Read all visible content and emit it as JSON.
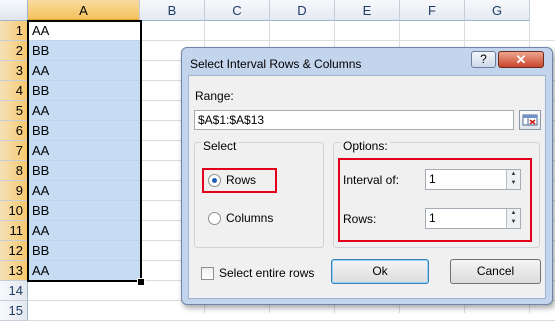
{
  "sheet": {
    "columns": [
      "A",
      "B",
      "C",
      "D",
      "E",
      "F",
      "G"
    ],
    "selected_column": "A",
    "rows": [
      {
        "num": "1",
        "value": "AA"
      },
      {
        "num": "2",
        "value": "BB"
      },
      {
        "num": "3",
        "value": "AA"
      },
      {
        "num": "4",
        "value": "BB"
      },
      {
        "num": "5",
        "value": "AA"
      },
      {
        "num": "6",
        "value": "BB"
      },
      {
        "num": "7",
        "value": "AA"
      },
      {
        "num": "8",
        "value": "BB"
      },
      {
        "num": "9",
        "value": "AA"
      },
      {
        "num": "10",
        "value": "BB"
      },
      {
        "num": "11",
        "value": "AA"
      },
      {
        "num": "12",
        "value": "BB"
      },
      {
        "num": "13",
        "value": "AA"
      },
      {
        "num": "14",
        "value": ""
      },
      {
        "num": "15",
        "value": ""
      }
    ],
    "selection_color": "#c6dcf2"
  },
  "dialog": {
    "title": "Select Interval Rows & Columns",
    "help_label": "?",
    "close_label": "✕",
    "range_label": "Range:",
    "range_value": "$A$1:$A$13",
    "range_button_icon": "range-select-icon",
    "select_group_title": "Select",
    "rows_option": "Rows",
    "columns_option": "Columns",
    "selected_option": "Rows",
    "options_group_title": "Options:",
    "interval_label": "Interval of:",
    "interval_value": "1",
    "rows_label": "Rows:",
    "rows_value": "1",
    "select_entire_rows_label": "Select entire rows",
    "select_entire_rows_checked": false,
    "ok_label": "Ok",
    "cancel_label": "Cancel",
    "highlight_color": "#e2001a"
  }
}
